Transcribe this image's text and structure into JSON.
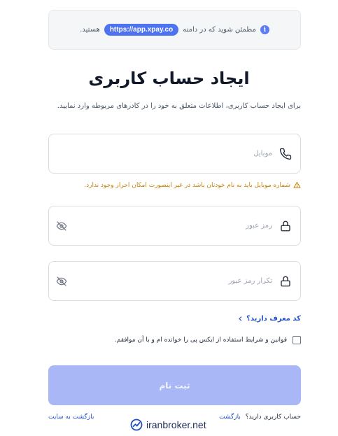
{
  "notice": {
    "prefix": "مطمئن شوید که در دامنه",
    "url": "https://app.xpay.co",
    "suffix": "هستید."
  },
  "page": {
    "title": "ایجاد حساب کاربری",
    "subtitle": "برای ایجاد حساب کاربری، اطلاعات متعلق به خود را در کادرهای مربوطه وارد نمایید."
  },
  "form": {
    "mobile_placeholder": "موبایل",
    "mobile_warning": "شماره موبایل باید به نام خودتان باشد در غیر اینصورت امکان احراز وجود ندارد.",
    "password_placeholder": "رمز عبور",
    "confirm_password_placeholder": "تکرار رمز عبور",
    "referral_label": "کد معرف دارید؟",
    "terms_label": "قوانین و شرایط استفاده از ایکس پی را خوانده ام و با آن موافقم.",
    "submit_label": "ثبت نام"
  },
  "footer": {
    "have_account": "حساب کاربری دارید؟",
    "login_link": "بازگشت",
    "back_to_site": "بازگشت به سایت"
  },
  "watermark": {
    "text": "iranbroker.net"
  },
  "colors": {
    "accent": "#4e73f0",
    "submit_disabled": "#a9b7f7",
    "warning": "#c2830b",
    "link": "#2450c4"
  }
}
